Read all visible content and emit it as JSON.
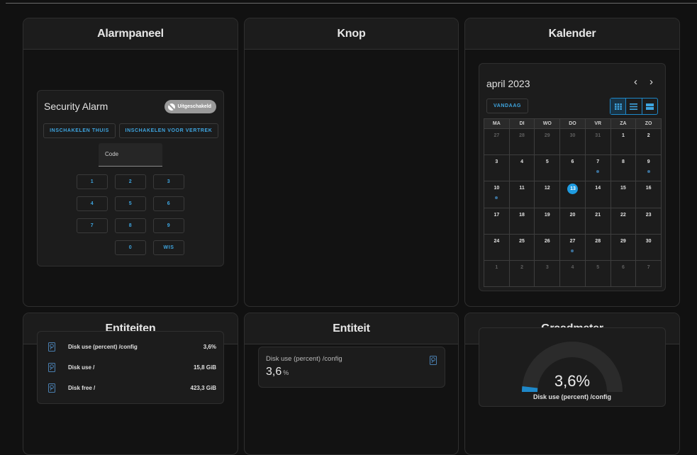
{
  "panels": {
    "alarm": {
      "title": "Alarmpaneel",
      "card_title": "Security Alarm",
      "badge": "Uitgeschakeld",
      "arm_home": "INSCHAKELEN THUIS",
      "arm_away": "INSCHAKELEN VOOR VERTREK",
      "code_label": "Code",
      "keys": [
        "1",
        "2",
        "3",
        "4",
        "5",
        "6",
        "7",
        "8",
        "9",
        "0",
        "WIS"
      ]
    },
    "button": {
      "title": "Knop"
    },
    "calendar": {
      "title": "Kalender",
      "month": "april 2023",
      "prev_icon": "‹",
      "next_icon": "›",
      "today": "VANDAAG",
      "views": [
        "grid-view-icon",
        "list-view-icon",
        "week-view-icon"
      ],
      "weekdays": [
        "MA",
        "DI",
        "WO",
        "DO",
        "VR",
        "ZA",
        "ZO"
      ],
      "days": [
        {
          "n": "27",
          "other": true
        },
        {
          "n": "28",
          "other": true
        },
        {
          "n": "29",
          "other": true
        },
        {
          "n": "30",
          "other": true
        },
        {
          "n": "31",
          "other": true
        },
        {
          "n": "1"
        },
        {
          "n": "2"
        },
        {
          "n": "3"
        },
        {
          "n": "4"
        },
        {
          "n": "5"
        },
        {
          "n": "6"
        },
        {
          "n": "7",
          "event": true
        },
        {
          "n": "8"
        },
        {
          "n": "9",
          "event": true
        },
        {
          "n": "10",
          "event": true
        },
        {
          "n": "11"
        },
        {
          "n": "12"
        },
        {
          "n": "13",
          "today": true
        },
        {
          "n": "14"
        },
        {
          "n": "15"
        },
        {
          "n": "16"
        },
        {
          "n": "17"
        },
        {
          "n": "18"
        },
        {
          "n": "19"
        },
        {
          "n": "20"
        },
        {
          "n": "21"
        },
        {
          "n": "22"
        },
        {
          "n": "23"
        },
        {
          "n": "24"
        },
        {
          "n": "25"
        },
        {
          "n": "26"
        },
        {
          "n": "27",
          "event": true
        },
        {
          "n": "28"
        },
        {
          "n": "29"
        },
        {
          "n": "30"
        },
        {
          "n": "1",
          "other": true
        },
        {
          "n": "2",
          "other": true
        },
        {
          "n": "3",
          "other": true
        },
        {
          "n": "4",
          "other": true
        },
        {
          "n": "5",
          "other": true
        },
        {
          "n": "6",
          "other": true
        },
        {
          "n": "7",
          "other": true
        }
      ]
    },
    "entities": {
      "title": "Entiteiten",
      "rows": [
        {
          "name": "Disk use (percent) /config",
          "value": "3,6%"
        },
        {
          "name": "Disk use /",
          "value": "15,8 GiB"
        },
        {
          "name": "Disk free /",
          "value": "423,3 GiB"
        }
      ]
    },
    "entity": {
      "title": "Entiteit",
      "name": "Disk use (percent) /config",
      "value": "3,6",
      "unit": "%"
    },
    "gauge": {
      "title": "Graadmeter",
      "value": "3,6%",
      "percent": 3.6,
      "label": "Disk use (percent) /config"
    }
  },
  "colors": {
    "accent": "#3ea5e0",
    "today": "#1e9be0",
    "gauge_fill": "#1e88c9",
    "gauge_track": "#2b2b2b",
    "icon": "#4a7fb0"
  }
}
